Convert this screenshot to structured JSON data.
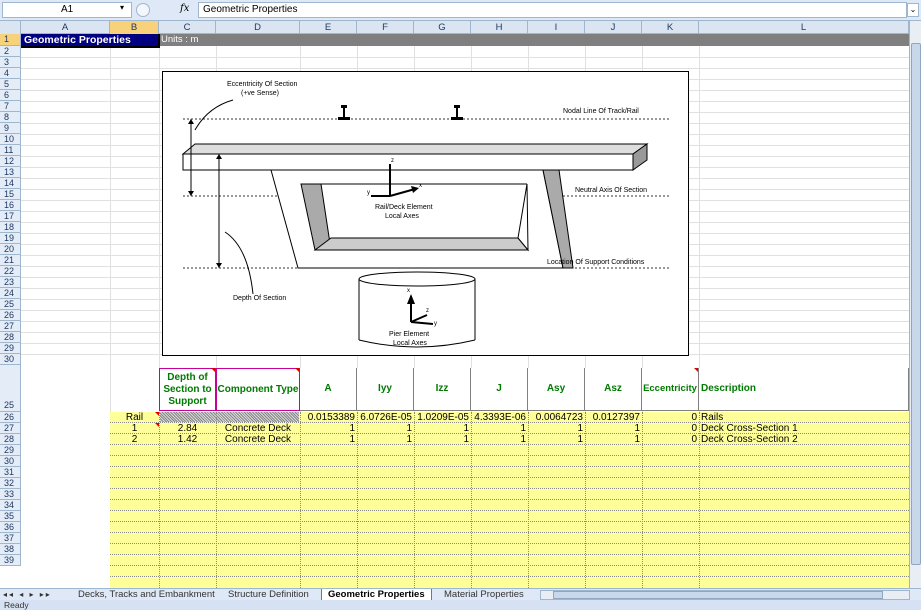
{
  "formula_bar": {
    "name_box": "A1",
    "fx_label": "fx",
    "formula": "Geometric Properties"
  },
  "columns": [
    "A",
    "B",
    "C",
    "D",
    "E",
    "F",
    "G",
    "H",
    "I",
    "J",
    "K",
    "L"
  ],
  "rows": [
    "1",
    "2",
    "3",
    "4",
    "5",
    "6",
    "7",
    "8",
    "9",
    "10",
    "11",
    "12",
    "13",
    "14",
    "15",
    "16",
    "17",
    "18",
    "19",
    "20",
    "21",
    "22",
    "23",
    "24",
    "25",
    "26",
    "27",
    "28",
    "29",
    "30",
    "31",
    "32",
    "33",
    "34",
    "35",
    "36",
    "37",
    "38",
    "39"
  ],
  "sheet": {
    "title": "Geometric Properties",
    "units": "Units : m"
  },
  "diagram": {
    "eccentricity": "Eccentricity Of Section",
    "eccentricity_sense": "(+ve Sense)",
    "nodal_line": "Nodal Line Of Track/Rail",
    "neutral_axis": "Neutral Axis Of Section",
    "rail_deck_1": "Rail/Deck Element",
    "rail_deck_2": "Local Axes",
    "support": "Location Of Support Conditions",
    "depth": "Depth Of Section",
    "pier_1": "Pier Element",
    "pier_2": "Local Axes",
    "axis_x": "x",
    "axis_y": "y",
    "axis_z": "z"
  },
  "table": {
    "headers": {
      "depth": "Depth of Section to Support",
      "component": "Component Type",
      "a": "A",
      "iyy": "Iyy",
      "izz": "Izz",
      "j": "J",
      "asy": "Asy",
      "asz": "Asz",
      "ecc": "Eccentricity",
      "desc": "Description"
    },
    "rows": [
      {
        "label": "Rail",
        "depth": "",
        "component": "",
        "a": "0.0153389",
        "iyy": "6.0726E-05",
        "izz": "1.0209E-05",
        "j": "4.3393E-06",
        "asy": "0.0064723",
        "asz": "0.0127397",
        "ecc": "0",
        "desc": "Rails"
      },
      {
        "label": "1",
        "depth": "2.84",
        "component": "Concrete Deck",
        "a": "1",
        "iyy": "1",
        "izz": "1",
        "j": "1",
        "asy": "1",
        "asz": "1",
        "ecc": "0",
        "desc": "Deck Cross-Section 1"
      },
      {
        "label": "2",
        "depth": "1.42",
        "component": "Concrete Deck",
        "a": "1",
        "iyy": "1",
        "izz": "1",
        "j": "1",
        "asy": "1",
        "asz": "1",
        "ecc": "0",
        "desc": "Deck Cross-Section 2"
      }
    ]
  },
  "tabs": {
    "nav": "◂◂ ◂ ▸ ▸▸",
    "t1": "Decks, Tracks and Embankment",
    "t2": "Structure Definition",
    "t3": "Geometric Properties",
    "t4": "Material Properties"
  },
  "status": "Ready"
}
